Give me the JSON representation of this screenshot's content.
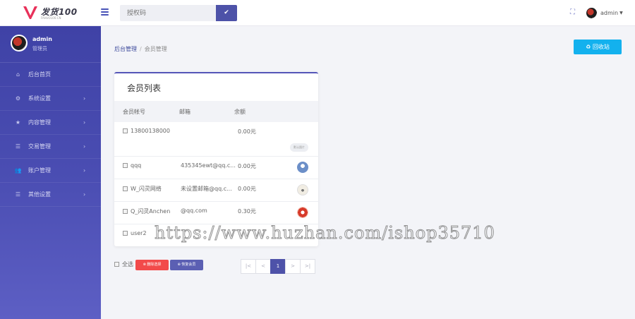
{
  "header": {
    "logo_text": "发货100",
    "logo_sub": "FAHUO100.CN",
    "search_placeholder": "授权码",
    "user_name": "admin"
  },
  "sidebar": {
    "user_name": "admin",
    "user_role": "管理员",
    "items": [
      {
        "label": "后台首页",
        "icon": "home-icon",
        "has_arrow": false
      },
      {
        "label": "系统设置",
        "icon": "gear-icon",
        "has_arrow": true
      },
      {
        "label": "内容管理",
        "icon": "star-icon",
        "has_arrow": true
      },
      {
        "label": "交易管理",
        "icon": "list-icon",
        "has_arrow": true
      },
      {
        "label": "账户管理",
        "icon": "users-icon",
        "has_arrow": true
      },
      {
        "label": "其他设置",
        "icon": "list-icon",
        "has_arrow": true
      }
    ]
  },
  "breadcrumb": {
    "root": "后台管理",
    "current": "会员管理"
  },
  "recycle_button": "回收站",
  "card": {
    "title": "会员列表",
    "columns": [
      "会员帐号",
      "邮箱",
      "余额"
    ],
    "rows": [
      {
        "account": "13800138000",
        "email": "",
        "balance": "0.00元",
        "action": "默认图片"
      },
      {
        "account": "qqq",
        "email": "435345ewt@qq.c...",
        "balance": "0.00元"
      },
      {
        "account": "W_闪灵网络",
        "email": "未设置邮箱@qq.c...",
        "balance": "0.00元"
      },
      {
        "account": "Q_闪灵Anchen",
        "email": "@qq.com",
        "balance": "0.30元"
      },
      {
        "account": "user2",
        "email": "",
        "balance": ""
      }
    ]
  },
  "bottom": {
    "select_all": "全选",
    "delete_button": "删除选择",
    "restore_button": "恢复会员"
  },
  "pager": {
    "first": "|<",
    "prev": "<",
    "current": "1",
    "next": ">",
    "last": ">|"
  },
  "watermark": "https://www.huzhan.com/ishop35710",
  "colors": {
    "accent": "#4d52a8",
    "sidebar": "#4a4db2",
    "recycle": "#13b1ee",
    "danger": "#f24a4a"
  }
}
